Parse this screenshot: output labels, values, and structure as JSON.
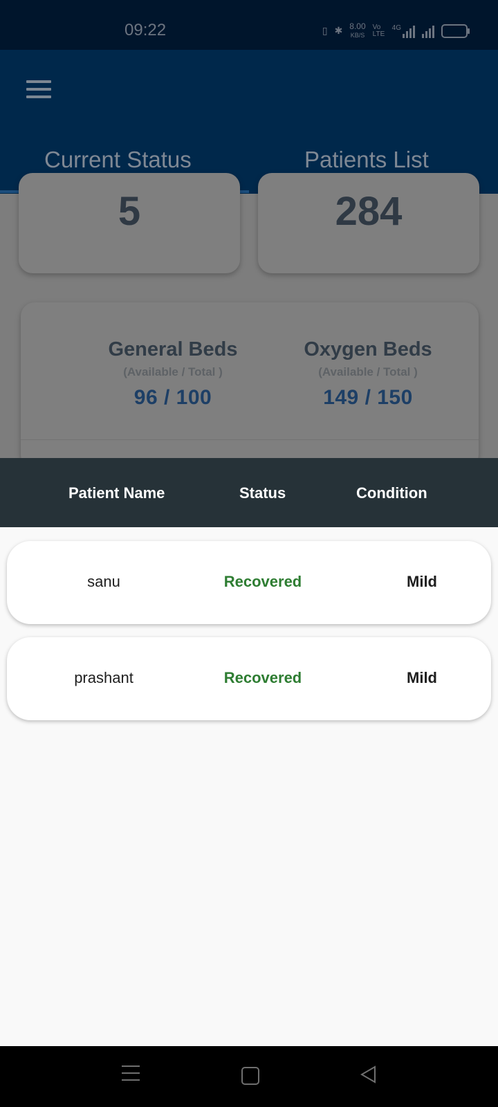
{
  "status_bar": {
    "time": "09:22",
    "speed": "8.00",
    "speed_unit": "KB/S",
    "net1": "Vo LTE",
    "net2": "4G"
  },
  "app_bar": {
    "menu_icon": "hamburger-icon",
    "tabs": [
      {
        "label": "Current Status",
        "selected": true
      },
      {
        "label": "Patients List",
        "selected": false
      }
    ]
  },
  "summary": {
    "left_value": "5",
    "right_value": "284"
  },
  "beds": {
    "general": {
      "title": "General Beds",
      "subtitle": "(Available / Total )",
      "value": "96 / 100"
    },
    "oxygen": {
      "title": "Oxygen Beds",
      "subtitle": "(Available / Total )",
      "value": "149 / 150"
    }
  },
  "patients_table": {
    "headers": {
      "name": "Patient Name",
      "status": "Status",
      "condition": "Condition"
    },
    "rows": [
      {
        "name": "sanu",
        "status": "Recovered",
        "condition": "Mild"
      },
      {
        "name": "prashant",
        "status": "Recovered",
        "condition": "Mild"
      }
    ]
  },
  "colors": {
    "app_bar": "#00284b",
    "header": "#263238",
    "recovered": "#2e7d32"
  },
  "nav_bar": {
    "icons": [
      "menu-icon",
      "home-icon",
      "back-icon"
    ]
  }
}
